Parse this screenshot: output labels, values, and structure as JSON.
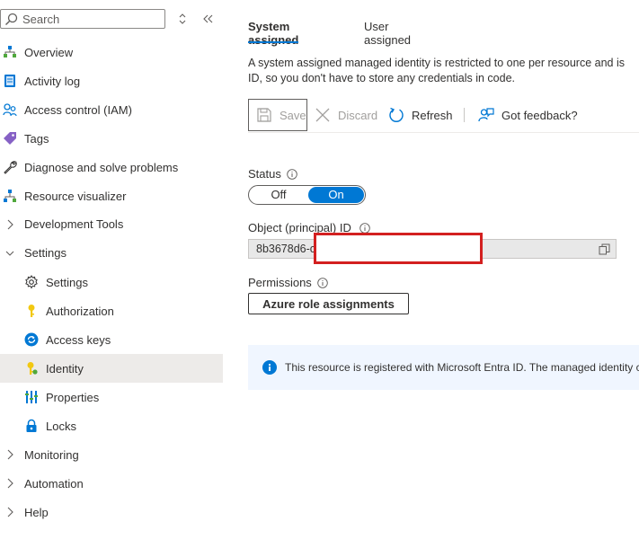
{
  "sidebar": {
    "search_placeholder": "Search",
    "items": [
      {
        "label": "Overview",
        "icon": "overview-icon"
      },
      {
        "label": "Activity log",
        "icon": "activity-log-icon"
      },
      {
        "label": "Access control (IAM)",
        "icon": "access-control-icon"
      },
      {
        "label": "Tags",
        "icon": "tag-icon"
      },
      {
        "label": "Diagnose and solve problems",
        "icon": "wrench-icon"
      },
      {
        "label": "Resource visualizer",
        "icon": "resource-visualizer-icon"
      },
      {
        "label": "Development Tools",
        "icon": "chevron-right-icon"
      },
      {
        "label": "Settings",
        "icon": "chevron-down-icon"
      },
      {
        "label": "Settings",
        "icon": "gear-icon"
      },
      {
        "label": "Authorization",
        "icon": "key-icon"
      },
      {
        "label": "Access keys",
        "icon": "access-keys-icon"
      },
      {
        "label": "Identity",
        "icon": "identity-key-icon",
        "selected": true
      },
      {
        "label": "Properties",
        "icon": "properties-icon"
      },
      {
        "label": "Locks",
        "icon": "lock-icon"
      },
      {
        "label": "Monitoring",
        "icon": "chevron-right-icon"
      },
      {
        "label": "Automation",
        "icon": "chevron-right-icon"
      },
      {
        "label": "Help",
        "icon": "chevron-right-icon"
      }
    ]
  },
  "main": {
    "tabs": [
      {
        "label": "System assigned",
        "active": true
      },
      {
        "label": "User assigned",
        "active": false
      }
    ],
    "description_line1": "A system assigned managed identity is restricted to one per resource and is",
    "description_line2": "ID, so you don't have to store any credentials in code.",
    "toolbar": {
      "save": "Save",
      "discard": "Discard",
      "refresh": "Refresh",
      "feedback": "Got feedback?"
    },
    "status_label": "Status",
    "status_off": "Off",
    "status_on": "On",
    "object_id_label": "Object (principal) ID",
    "object_id_value": "8b3678d6-c",
    "permissions_label": "Permissions",
    "role_button": "Azure role assignments",
    "info_text": "This resource is registered with Microsoft Entra ID. The managed identity ca"
  },
  "colors": {
    "accent": "#0078d4",
    "selected_bg": "#edebe9",
    "info_bg": "#f0f6ff",
    "redaction_border": "#d32020"
  }
}
